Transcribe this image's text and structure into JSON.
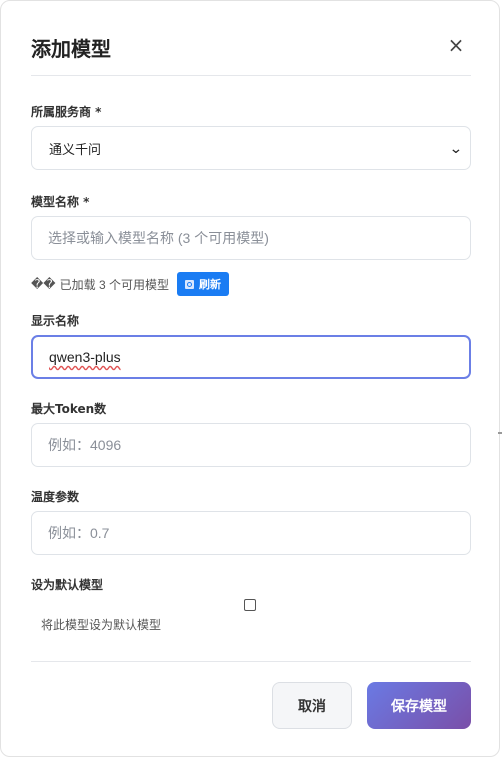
{
  "dialog": {
    "title": "添加模型",
    "close_symbol": "×"
  },
  "provider": {
    "label": "所属服务商 *",
    "selected": "通义千问"
  },
  "model_name": {
    "label": "模型名称 *",
    "placeholder": "选择或输入模型名称 (3 个可用模型)",
    "value": "",
    "hint_prefix": "��",
    "hint_text": "已加载 3 个可用模型",
    "refresh_label": "刷新"
  },
  "display_name": {
    "label": "显示名称",
    "value": "qwen3-plus"
  },
  "max_tokens": {
    "label": "最大Token数",
    "placeholder": "例如：4096",
    "value": ""
  },
  "temperature": {
    "label": "温度参数",
    "placeholder": "例如：0.7",
    "value": ""
  },
  "default_model": {
    "label": "设为默认模型",
    "checked": false,
    "description": "将此模型设为默认模型"
  },
  "actions": {
    "cancel_label": "取消",
    "save_label": "保存模型"
  },
  "colors": {
    "accent_focus": "#6b7fe6",
    "refresh_button": "#1a7cf3",
    "save_gradient_start": "#6a7ae4",
    "save_gradient_end": "#7a4fa8"
  }
}
